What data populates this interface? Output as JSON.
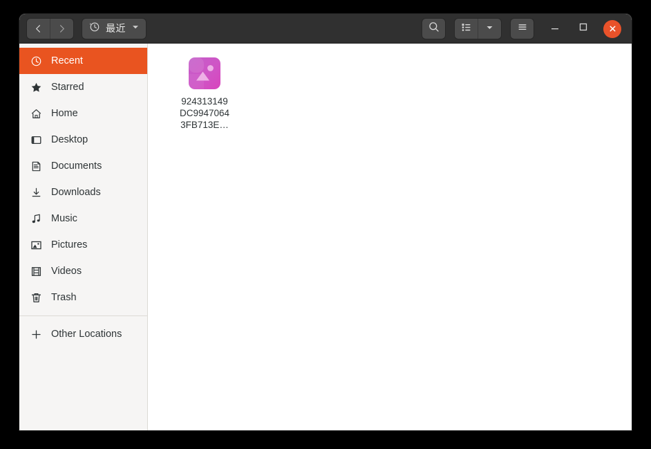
{
  "window": {
    "title": "Files",
    "titlebar": {
      "back_button": "Back",
      "forward_button": "Forward",
      "path_label": "最近",
      "path_icon": "history-clock-icon",
      "path_dropdown_icon": "chevron-down-icon",
      "search_icon": "search-icon",
      "view_list_icon": "list-view-icon",
      "view_dropdown_icon": "chevron-down-icon",
      "menu_icon": "hamburger-menu-icon",
      "minimize_label": "Minimize",
      "maximize_label": "Maximize",
      "close_label": "Close"
    }
  },
  "colors": {
    "accent": "#e95420",
    "headerbar": "#303030",
    "button": "#4b4b4b",
    "sidebar_bg": "#f6f5f4",
    "content_bg": "#ffffff",
    "text": "#2e3436",
    "icon_gradient_start": "#c060c8",
    "icon_gradient_end": "#d94bc4"
  },
  "sidebar": {
    "items": [
      {
        "label": "Recent",
        "icon": "clock-icon",
        "selected": true
      },
      {
        "label": "Starred",
        "icon": "star-icon",
        "selected": false
      },
      {
        "label": "Home",
        "icon": "home-icon",
        "selected": false
      },
      {
        "label": "Desktop",
        "icon": "desktop-icon",
        "selected": false
      },
      {
        "label": "Documents",
        "icon": "documents-icon",
        "selected": false
      },
      {
        "label": "Downloads",
        "icon": "downloads-icon",
        "selected": false
      },
      {
        "label": "Music",
        "icon": "music-icon",
        "selected": false
      },
      {
        "label": "Pictures",
        "icon": "pictures-icon",
        "selected": false
      },
      {
        "label": "Videos",
        "icon": "videos-icon",
        "selected": false
      },
      {
        "label": "Trash",
        "icon": "trash-icon",
        "selected": false
      }
    ],
    "other_locations": {
      "label": "Other Locations",
      "icon": "plus-icon"
    }
  },
  "content": {
    "files": [
      {
        "name_lines": [
          "924313149",
          "DC9947064",
          "3FB713E…"
        ],
        "name_full": "924313149DC99470643FB713E…",
        "icon": "image-file-icon",
        "selected": false
      }
    ]
  }
}
